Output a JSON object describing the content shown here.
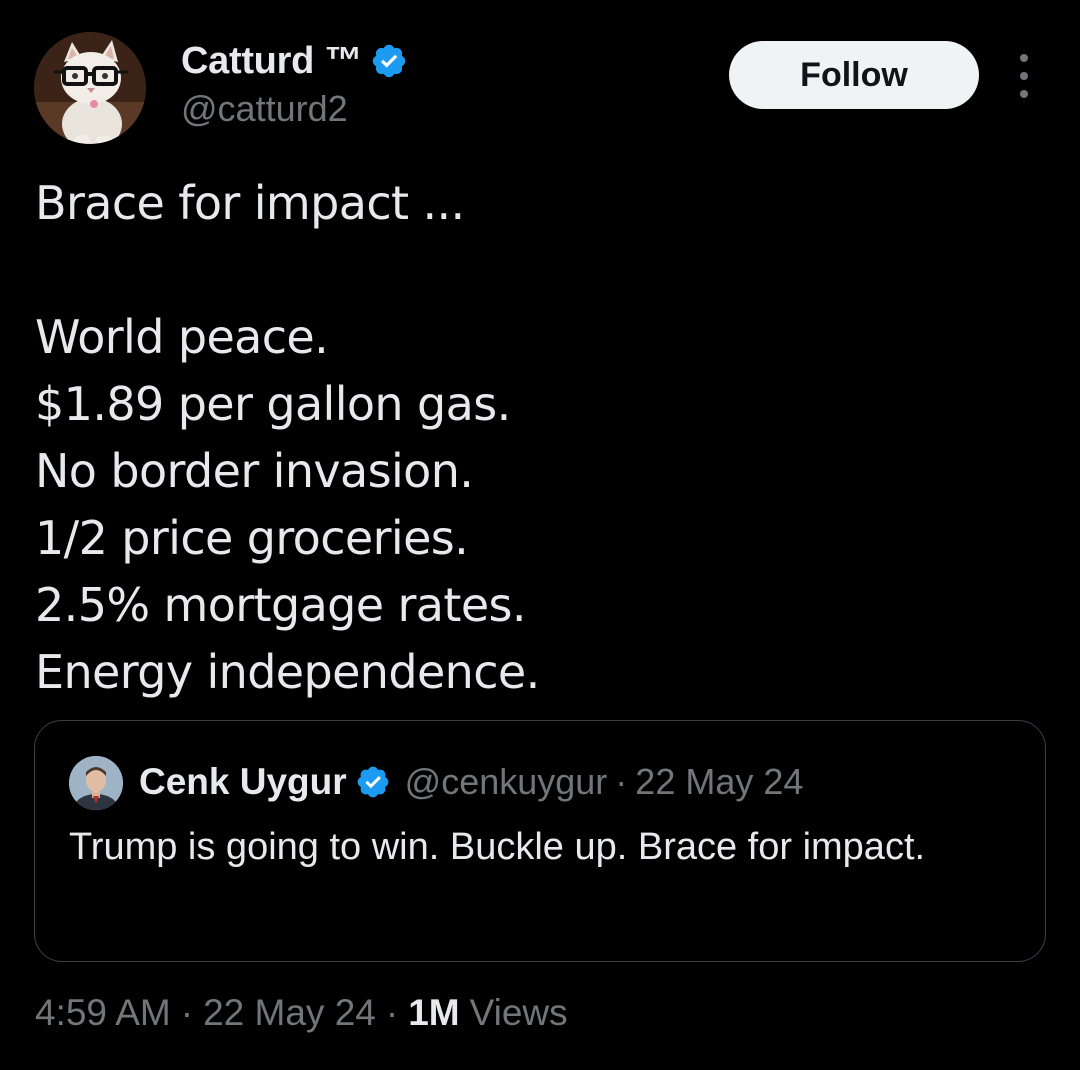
{
  "author": {
    "display_name": "Catturd ™",
    "handle": "@catturd2",
    "avatar_icon": "cat-with-glasses-avatar",
    "verified_color": "#1d9bf0"
  },
  "actions": {
    "follow_label": "Follow",
    "more_icon": "more-vertical-icon"
  },
  "tweet": {
    "lines": [
      "Brace for impact ...",
      "",
      "World peace.",
      "$1.89 per gallon gas.",
      "No border invasion.",
      "1/2 price groceries.",
      "2.5% mortgage rates.",
      "Energy independence."
    ]
  },
  "quoted_tweet": {
    "display_name": "Cenk Uygur",
    "handle": "@cenkuygur",
    "separator": "·",
    "date": "22 May 24",
    "text": "Trump is going to win. Buckle up. Brace for impact.",
    "avatar_icon": "person-avatar"
  },
  "meta": {
    "time": "4:59 AM",
    "separator": "·",
    "date": "22 May 24",
    "views_count": "1M",
    "views_label": "Views"
  },
  "colors": {
    "background": "#000000",
    "text_primary": "#e7e9ea",
    "text_secondary": "#71767b",
    "border": "#3a3f44",
    "button_bg": "#eff3f4"
  }
}
